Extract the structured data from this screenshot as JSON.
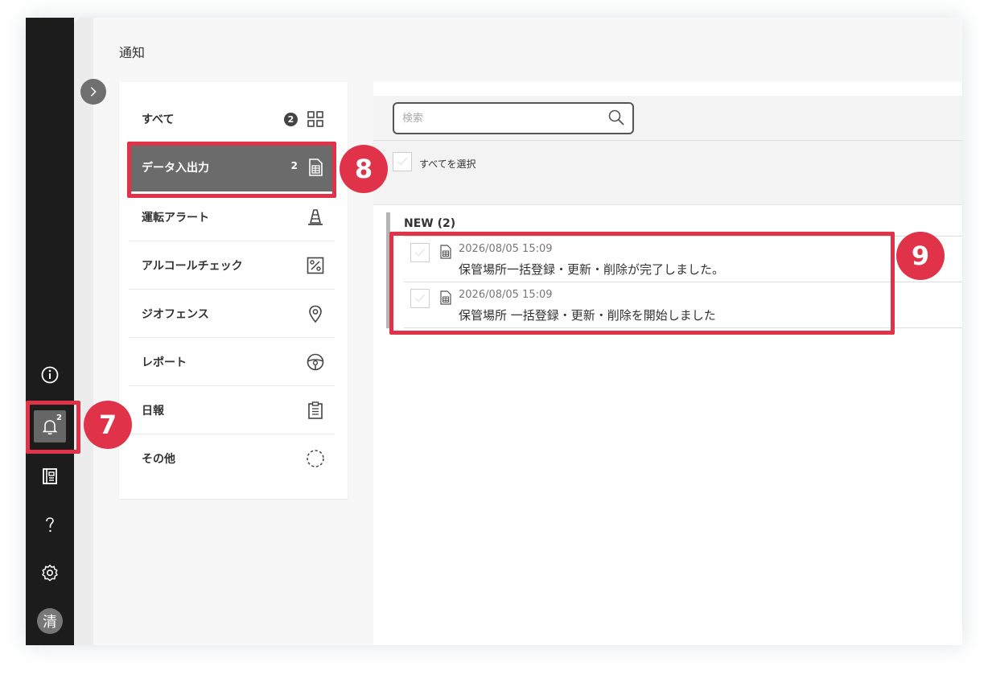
{
  "page_title": "通知",
  "categories": [
    {
      "label": "すべて",
      "count": "2",
      "icon": "grid-icon"
    },
    {
      "label": "データ入出力",
      "count": "2",
      "icon": "spreadsheet-icon",
      "active": true
    },
    {
      "label": "運転アラート",
      "count": "",
      "icon": "traffic-cone-icon"
    },
    {
      "label": "アルコールチェック",
      "count": "",
      "icon": "percent-icon"
    },
    {
      "label": "ジオフェンス",
      "count": "",
      "icon": "location-pin-icon"
    },
    {
      "label": "レポート",
      "count": "",
      "icon": "steering-wheel-icon"
    },
    {
      "label": "日報",
      "count": "",
      "icon": "clipboard-icon"
    },
    {
      "label": "その他",
      "count": "",
      "icon": "dashed-circle-icon"
    }
  ],
  "search": {
    "placeholder": "検索"
  },
  "select_all_label": "すべてを選択",
  "group": {
    "title": "NEW (2)"
  },
  "notifications": [
    {
      "time": "2026/08/05 15:09",
      "message": "保管場所一括登録・更新・削除が完了しました。"
    },
    {
      "time": "2026/08/05 15:09",
      "message": "保管場所 一括登録・更新・削除を開始しました"
    }
  ],
  "sidebar": {
    "bell_badge": "2",
    "avatar": "清"
  },
  "annotations": {
    "badge_7": "7",
    "badge_8": "8",
    "badge_9": "9"
  },
  "colors": {
    "annotation": "#e0334a",
    "rail": "#1c1c1c",
    "active_item": "#6b6b6b"
  }
}
